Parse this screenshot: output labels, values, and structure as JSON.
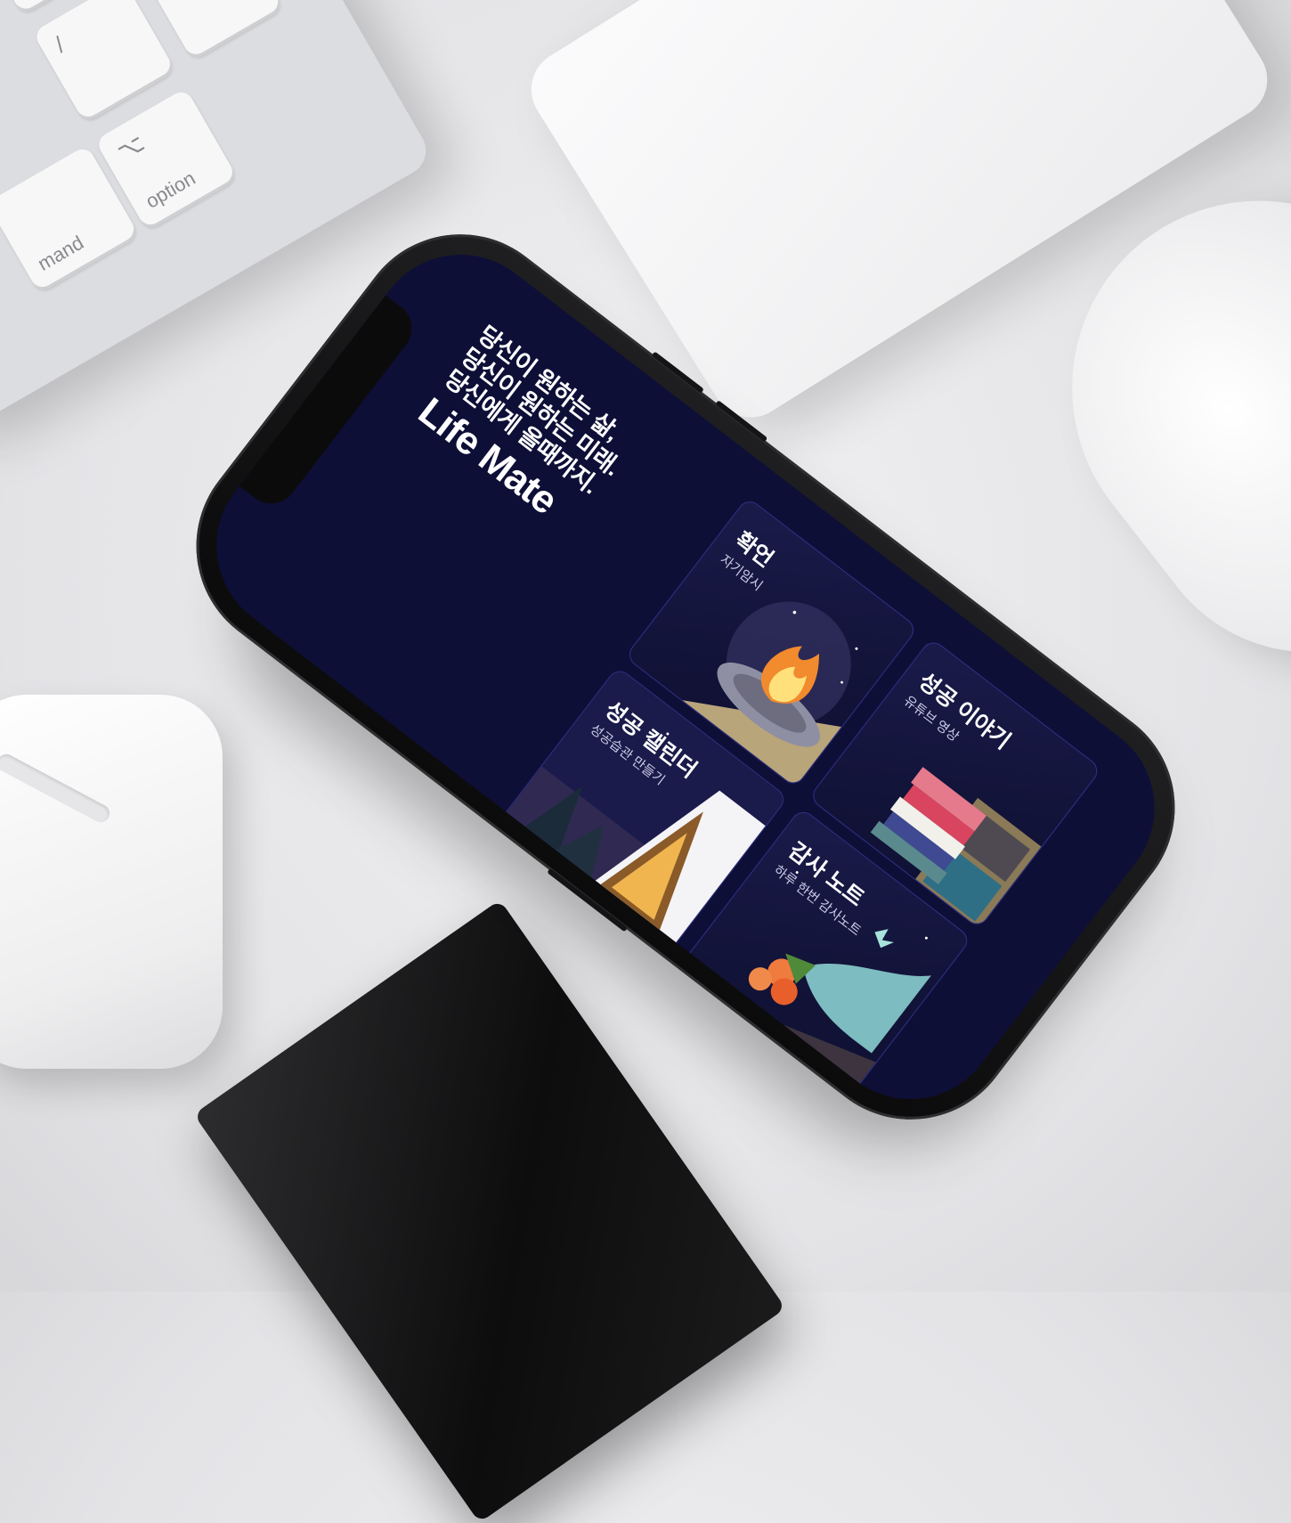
{
  "keyboard": {
    "keys": [
      {
        "label": "option",
        "symbol": "⌥"
      },
      {
        "label": "mand",
        "symbol": ""
      },
      {
        "label": "",
        "symbol": "▶"
      },
      {
        "label": "",
        "symbol": "/"
      }
    ]
  },
  "app": {
    "headline": {
      "line1": "당신이 원하는 삶,",
      "line2": "당신이 원하는 미래.",
      "line3": "당신에게 올때까지.",
      "brand": "Life Mate"
    },
    "cards": [
      {
        "title": "확언",
        "subtitle": "자기암시",
        "icon": "campfire-illustration"
      },
      {
        "title": "성공 이야기",
        "subtitle": "유튜브 영상",
        "icon": "bookshelf-illustration"
      },
      {
        "title": "성공 캘린더",
        "subtitle": "성공습관 만들기",
        "icon": "cabin-illustration"
      },
      {
        "title": "감사 노트",
        "subtitle": "하루 한번 감사노트",
        "icon": "bouquet-illustration"
      }
    ]
  },
  "colors": {
    "screen_bg": "#0e0f37",
    "card_border": "#2f3287",
    "text_primary": "#ffffff"
  }
}
